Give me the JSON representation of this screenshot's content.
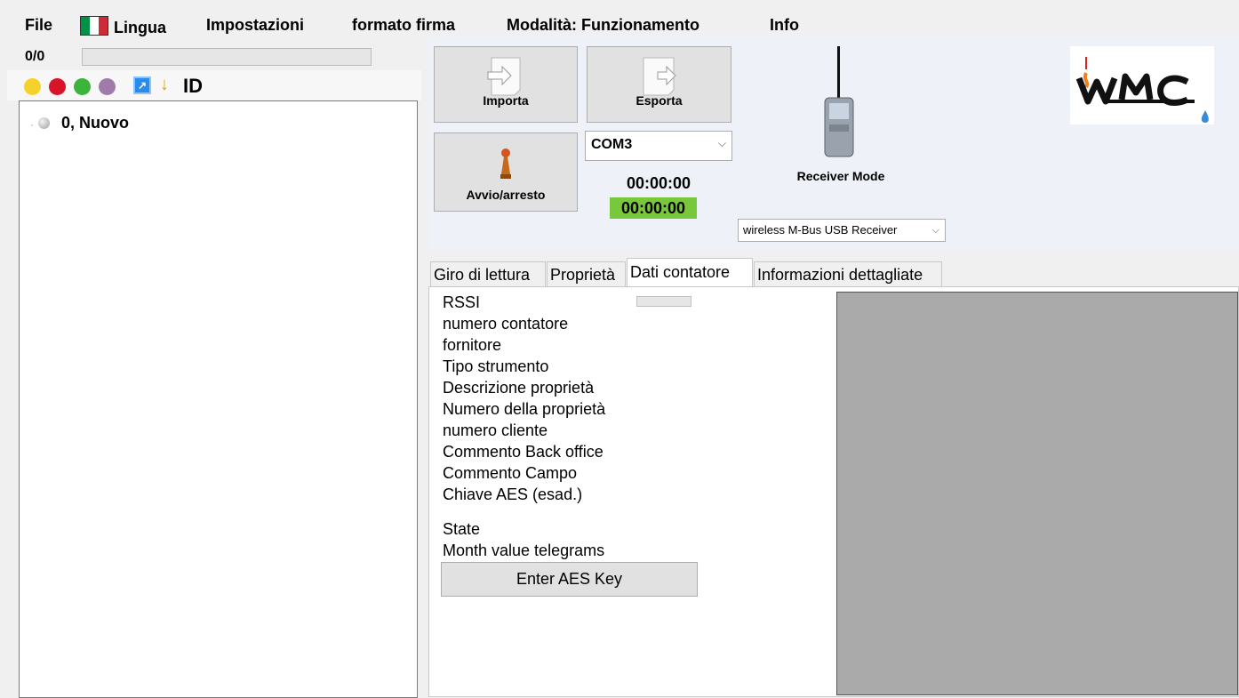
{
  "menu": {
    "file": "File",
    "lingua": "Lingua",
    "impostazioni": "Impostazioni",
    "formato_firma": "formato firma",
    "modalita": "Modalità: Funzionamento",
    "info": "Info"
  },
  "left": {
    "counter": "0/0",
    "id_label": "ID",
    "tree_node": "0, Nuovo",
    "filter_colors": [
      "#f5d22a",
      "#d7142a",
      "#3cb43c",
      "#a07aa8"
    ]
  },
  "toolbar": {
    "importa": "Importa",
    "esporta": "Esporta",
    "avvio": "Avvio/arresto",
    "port": "COM3",
    "timer": "00:00:00",
    "timer_active": "00:00:00",
    "receiver_mode": "Receiver Mode",
    "receiver_select": "wireless M-Bus USB Receiver"
  },
  "tabs": [
    "Giro di lettura",
    "Proprietà",
    "Dati contatore",
    "Informazioni dettagliate"
  ],
  "fields": [
    "RSSI",
    "numero contatore",
    "fornitore",
    "Tipo strumento",
    "Descrizione proprietà",
    "Numero della proprietà",
    "numero cliente",
    "Commento Back office",
    "Commento Campo",
    "Chiave AES (esad.)",
    "State",
    "Month value telegrams"
  ],
  "enter_aes_label": "Enter AES Key"
}
